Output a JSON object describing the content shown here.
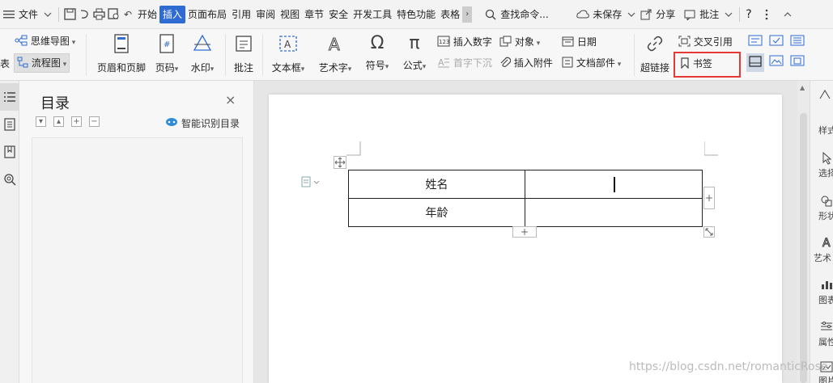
{
  "menubar": {
    "file_label": "文件",
    "tabs": [
      "开始",
      "插入",
      "页面布局",
      "引用",
      "审阅",
      "视图",
      "章节",
      "安全",
      "开发工具",
      "特色功能",
      "表格"
    ],
    "active_tab": "插入",
    "search_label": "查找命令...",
    "unsaved_label": "未保存",
    "share_label": "分享",
    "comment_label": "批注",
    "help_label": "?"
  },
  "ribbon": {
    "mindmap_label": "思维导图",
    "table_cut_label": "表",
    "flowchart_label": "流程图",
    "header_footer_label": "页眉和页脚",
    "page_number_label": "页码",
    "watermark_label": "水印",
    "comment_label": "批注",
    "textbox_label": "文本框",
    "wordart_label": "艺术字",
    "symbol_label": "符号",
    "formula_label": "公式",
    "insert_number_label": "插入数字",
    "object_label": "对象",
    "date_label": "日期",
    "dropcap_label": "首字下沉",
    "attachment_label": "插入附件",
    "doc_parts_label": "文档部件",
    "hyperlink_label": "超链接",
    "cross_ref_label": "交叉引用",
    "bookmark_label": "书签",
    "highlight_color": "#e53935"
  },
  "toc": {
    "title": "目录",
    "close": "×",
    "smart_label": "智能识别目录"
  },
  "document": {
    "rows": [
      {
        "label": "姓名",
        "value": ""
      },
      {
        "label": "年龄",
        "value": ""
      }
    ]
  },
  "rightbar": {
    "items": [
      "样式",
      "选择",
      "形状",
      "艺术",
      "图表",
      "属性",
      "图片"
    ]
  },
  "watermark": "https://blog.csdn.net/romanticRose"
}
